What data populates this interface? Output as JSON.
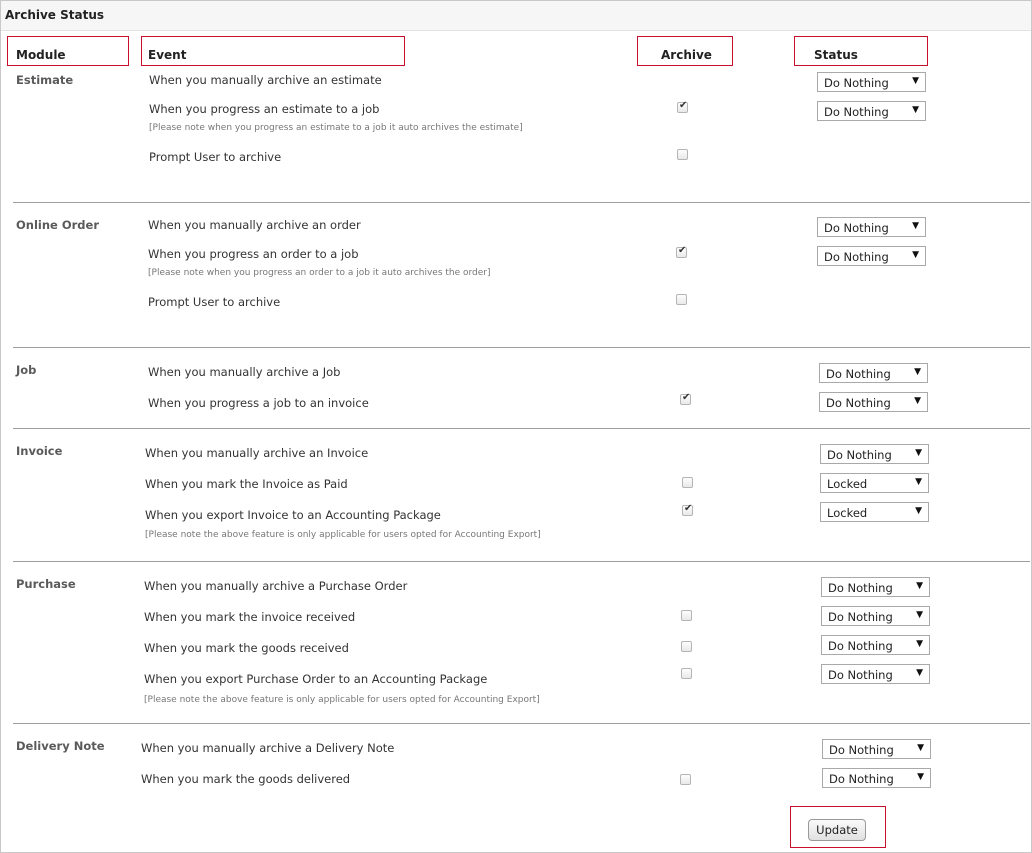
{
  "title": "Archive Status",
  "headers": {
    "module": "Module",
    "event": "Event",
    "archive": "Archive",
    "status": "Status"
  },
  "sections": [
    {
      "module": "Estimate",
      "rows": [
        {
          "event": "When you manually archive an estimate",
          "archive": null,
          "status": "Do Nothing"
        },
        {
          "event": "When you progress an estimate to a job",
          "note": "[Please note when you progress an estimate to a job it auto archives the estimate]",
          "archive": true,
          "status": "Do Nothing"
        },
        {
          "event": "Prompt User to archive",
          "archive": false,
          "status": null
        }
      ]
    },
    {
      "module": "Online Order",
      "rows": [
        {
          "event": "When you manually archive an order",
          "archive": null,
          "status": "Do Nothing"
        },
        {
          "event": "When you progress an order to a job",
          "note": "[Please note when you progress an order to a job it auto archives the order]",
          "archive": true,
          "status": "Do Nothing"
        },
        {
          "event": "Prompt User to archive",
          "archive": false,
          "status": null
        }
      ]
    },
    {
      "module": "Job",
      "rows": [
        {
          "event": "When you manually archive a Job",
          "archive": null,
          "status": "Do Nothing"
        },
        {
          "event": "When you progress a job to an invoice",
          "archive": true,
          "status": "Do Nothing"
        }
      ]
    },
    {
      "module": "Invoice",
      "rows": [
        {
          "event": "When you manually archive an Invoice",
          "archive": null,
          "status": "Do Nothing"
        },
        {
          "event": "When you mark the Invoice as Paid",
          "archive": false,
          "status": "Locked"
        },
        {
          "event": "When you export Invoice to an Accounting Package",
          "note": "[Please note the above feature is only applicable for users opted for Accounting Export]",
          "archive": true,
          "status": "Locked"
        }
      ]
    },
    {
      "module": "Purchase",
      "rows": [
        {
          "event": "When you manually archive a Purchase Order",
          "archive": null,
          "status": "Do Nothing"
        },
        {
          "event": "When you mark the invoice received",
          "archive": false,
          "status": "Do Nothing"
        },
        {
          "event": "When you mark the goods received",
          "archive": false,
          "status": "Do Nothing"
        },
        {
          "event": "When you export Purchase Order to an Accounting Package",
          "note": "[Please note the above feature is only applicable for users opted for Accounting Export]",
          "archive": false,
          "status": "Do Nothing"
        }
      ]
    },
    {
      "module": "Delivery Note",
      "rows": [
        {
          "event": "When you manually archive a Delivery Note",
          "archive": null,
          "status": "Do Nothing"
        },
        {
          "event": "When you mark the goods delivered",
          "archive": false,
          "status": "Do Nothing"
        }
      ]
    }
  ],
  "update_label": "Update",
  "colors": {
    "highlight": "#c8102e",
    "module_text": "#5a5a5a",
    "divider": "#9e9e9e"
  }
}
